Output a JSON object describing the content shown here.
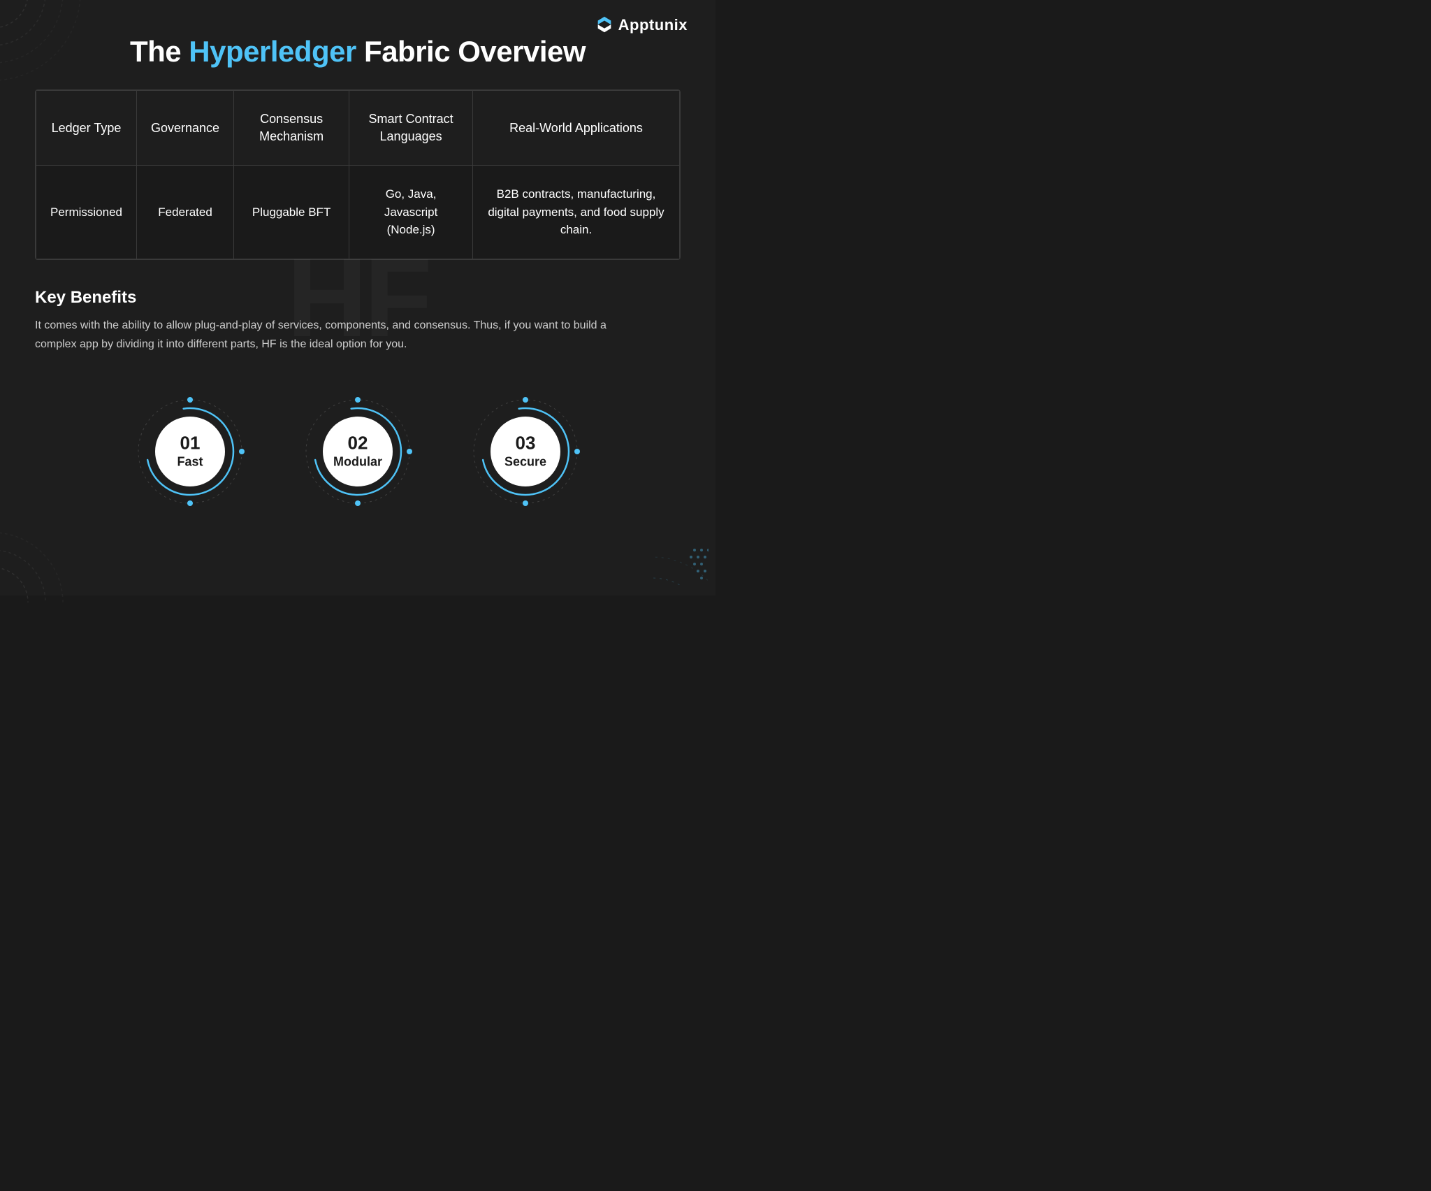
{
  "brand": {
    "logo_text": "Apptunix",
    "logo_icon": "A"
  },
  "title": {
    "prefix": "The ",
    "highlight": "Hyperledger",
    "suffix": " Fabric Overview"
  },
  "table": {
    "headers": [
      "Ledger Type",
      "Governance",
      "Consensus Mechanism",
      "Smart Contract Languages",
      "Real-World Applications"
    ],
    "row": [
      "Permissioned",
      "Federated",
      "Pluggable BFT",
      "Go, Java, Javascript (Node.js)",
      "B2B contracts, manufacturing, digital payments, and food supply chain."
    ]
  },
  "benefits": {
    "title": "Key Benefits",
    "text": "It comes with the ability to allow plug-and-play of services, components, and consensus. Thus, if you want to build a complex app by dividing it into different parts, HF is the ideal option for you."
  },
  "circles": [
    {
      "number": "01",
      "label": "Fast"
    },
    {
      "number": "02",
      "label": "Modular"
    },
    {
      "number": "03",
      "label": "Secure"
    }
  ],
  "colors": {
    "accent": "#4fc3f7",
    "bg": "#1e1e1e",
    "text": "#ffffff",
    "border": "#3a3a3a"
  }
}
